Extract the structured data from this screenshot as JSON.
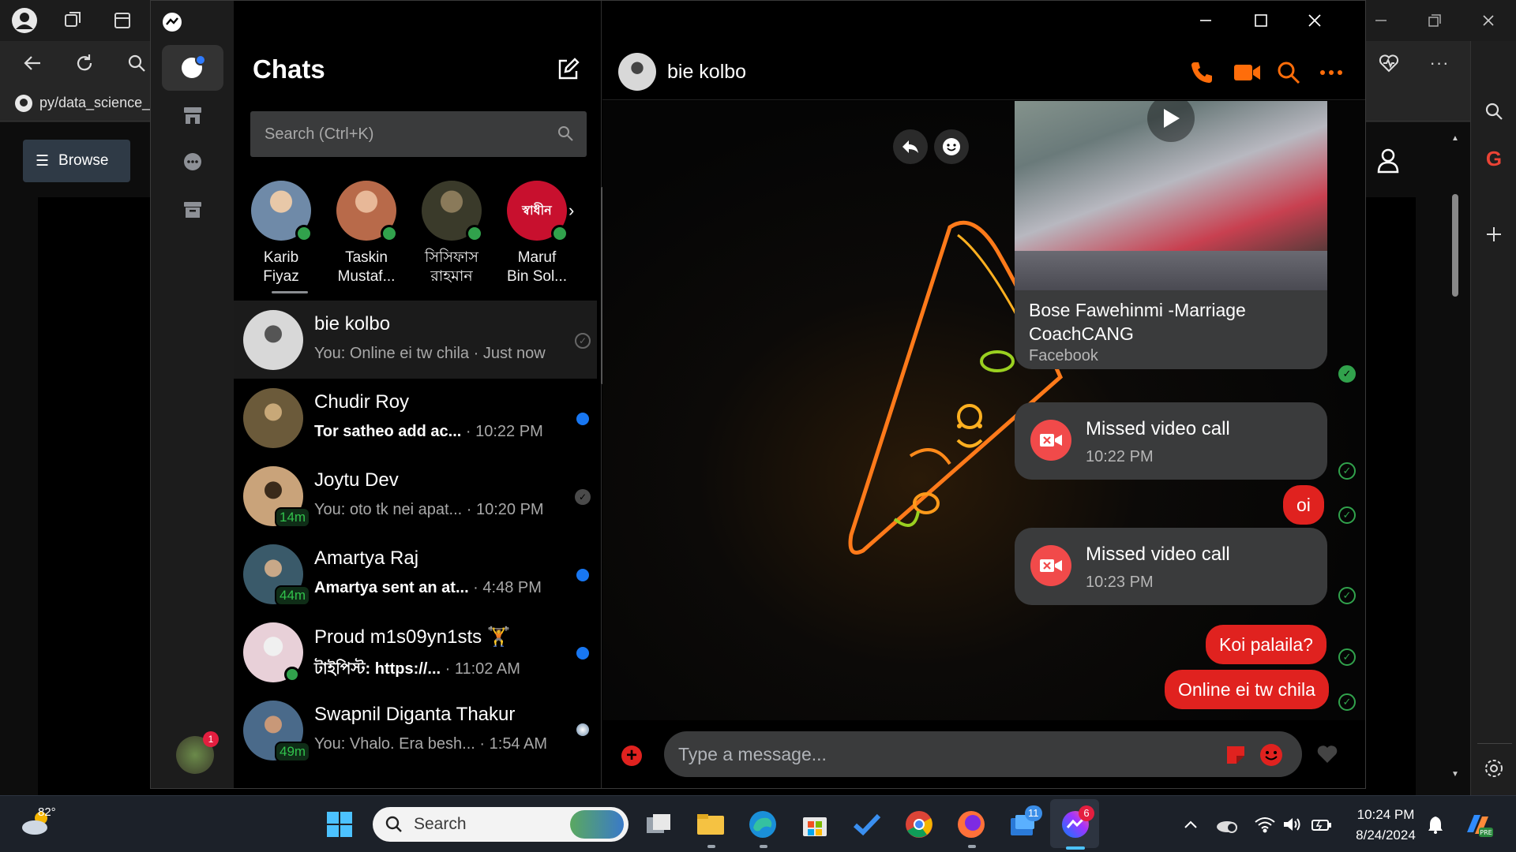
{
  "browser": {
    "bookmark_label": "py/data_science_r",
    "browse_button": "Browse"
  },
  "messenger": {
    "title": "Chats",
    "search_placeholder": "Search (Ctrl+K)",
    "stories": [
      {
        "name_line1": "Karib",
        "name_line2": "Fiyaz",
        "color": "#6f8aa8"
      },
      {
        "name_line1": "Taskin",
        "name_line2": "Mustaf...",
        "color": "#b86a4a"
      },
      {
        "name_line1": "সিসিফাস",
        "name_line2": "রাহমান",
        "color": "#4a4a3a"
      },
      {
        "name_line1": "Maruf",
        "name_line2": "Bin Sol...",
        "color": "#c8102e",
        "avatar_text": "স্বাধীন"
      }
    ],
    "conversations": [
      {
        "name": "bie kolbo",
        "preview": "You: Online ei tw chila · Just now",
        "unread": false,
        "color": "#c8c8c8"
      },
      {
        "name": "Chudir Roy",
        "preview": "Tor satheo add ac...",
        "time": " · 10:22 PM",
        "unread": true,
        "color": "#6b5a3a"
      },
      {
        "name": "Joytu Dev",
        "preview": "You: oto tk nei apat...",
        "time": " · 10:20 PM",
        "unread": false,
        "badge": "14m",
        "color": "#c9a37a"
      },
      {
        "name": "Amartya Raj",
        "preview": "Amartya sent an at...",
        "time": " · 4:48 PM",
        "unread": true,
        "badge": "44m",
        "color": "#3a5a6a"
      },
      {
        "name": "Proud m1s09yn1sts 🏋",
        "preview": "টাইপিস্ট: https://...",
        "time": " · 11:02 AM",
        "unread": true,
        "color": "#e8d0d8"
      },
      {
        "name": "Swapnil Diganta Thakur",
        "preview": "You: Vhalo. Era besh...",
        "time": " · 1:54 AM",
        "unread": false,
        "badge": "49m",
        "color": "#4a6a8a"
      }
    ],
    "profile_badge": "1"
  },
  "conversation": {
    "contact_name": "bie kolbo",
    "link_card": {
      "title": "Bose Fawehinmi -Marriage CoachCANG",
      "source": "Facebook"
    },
    "messages": [
      {
        "kind": "call",
        "title": "Missed video call",
        "time": "10:22 PM"
      },
      {
        "kind": "text",
        "text": "oi"
      },
      {
        "kind": "call",
        "title": "Missed video call",
        "time": "10:23 PM"
      },
      {
        "kind": "text",
        "text": "Koi palaila?"
      },
      {
        "kind": "text",
        "text": "Online ei tw chila"
      }
    ],
    "composer_placeholder": "Type a message..."
  },
  "taskbar": {
    "weather_temp": "82°",
    "search_label": "Search",
    "time": "10:24 PM",
    "date": "8/24/2024",
    "badge_mail": "11",
    "badge_messenger": "6"
  },
  "colors": {
    "accent_orange": "#ff6d0a",
    "message_red": "#e0221f",
    "online_green": "#31a24c",
    "unread_blue": "#1877f2"
  }
}
